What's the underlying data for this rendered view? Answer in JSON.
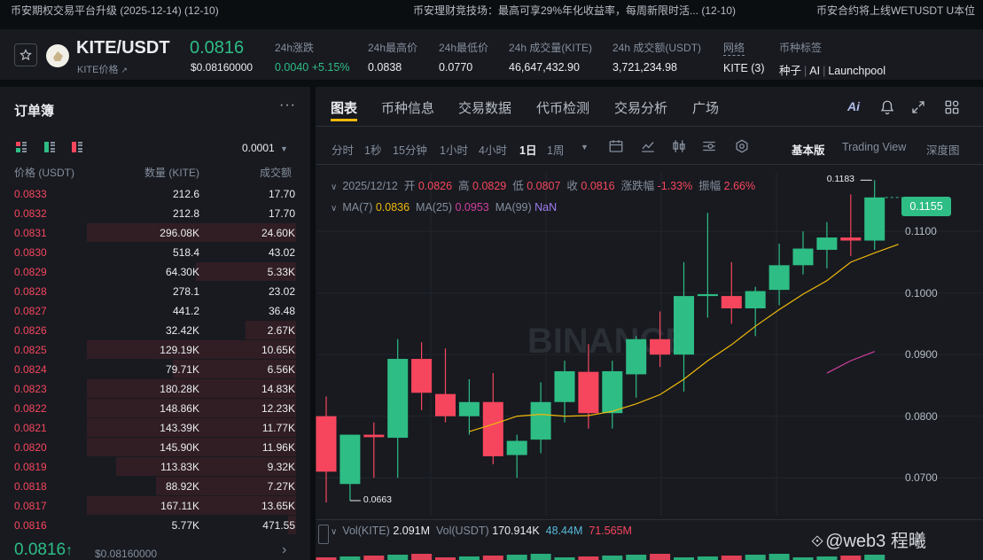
{
  "announcements": [
    "币安期权交易平台升级 (2025-12-14) (12-10)",
    "币安理财竞技场：最高可享29%年化收益率，每周新限时活... (12-10)",
    "币安合约将上线WETUSDT U本位"
  ],
  "ticker": {
    "pair": "KITE/USDT",
    "sub_label": "KITE价格",
    "last_price": "0.0816",
    "last_price_usd": "$0.08160000",
    "stats": [
      {
        "label": "24h涨跌",
        "value": "0.0040 +5.15%",
        "color": "green"
      },
      {
        "label": "24h最高价",
        "value": "0.0838"
      },
      {
        "label": "24h最低价",
        "value": "0.0770"
      },
      {
        "label": "24h 成交量(KITE)",
        "value": "46,647,432.90"
      },
      {
        "label": "24h 成交额(USDT)",
        "value": "3,721,234.98"
      },
      {
        "label": "网络",
        "value": "KITE (3)"
      }
    ],
    "tags_label": "币种标签",
    "tags": [
      "种子",
      "AI",
      "Launchpool"
    ]
  },
  "orderbook": {
    "title": "订单簿",
    "more": "···",
    "precision": "0.0001",
    "headers": {
      "price": "价格 (USDT)",
      "qty": "数量 (KITE)",
      "total": "成交额"
    },
    "asks": [
      {
        "price": "0.0833",
        "qty": "212.6",
        "total": "17.70",
        "depth": 0.0
      },
      {
        "price": "0.0832",
        "qty": "212.8",
        "total": "17.70",
        "depth": 0.0
      },
      {
        "price": "0.0831",
        "qty": "296.08K",
        "total": "24.60K",
        "depth": 1.0
      },
      {
        "price": "0.0830",
        "qty": "518.4",
        "total": "43.02",
        "depth": 0.0
      },
      {
        "price": "0.0829",
        "qty": "64.30K",
        "total": "5.33K",
        "depth": 0.48
      },
      {
        "price": "0.0828",
        "qty": "278.1",
        "total": "23.02",
        "depth": 0.0
      },
      {
        "price": "0.0827",
        "qty": "441.2",
        "total": "36.48",
        "depth": 0.0
      },
      {
        "price": "0.0826",
        "qty": "32.42K",
        "total": "2.67K",
        "depth": 0.24
      },
      {
        "price": "0.0825",
        "qty": "129.19K",
        "total": "10.65K",
        "depth": 1.0
      },
      {
        "price": "0.0824",
        "qty": "79.71K",
        "total": "6.56K",
        "depth": 0.59
      },
      {
        "price": "0.0823",
        "qty": "180.28K",
        "total": "14.83K",
        "depth": 1.0
      },
      {
        "price": "0.0822",
        "qty": "148.86K",
        "total": "12.23K",
        "depth": 1.0
      },
      {
        "price": "0.0821",
        "qty": "143.39K",
        "total": "11.77K",
        "depth": 1.0
      },
      {
        "price": "0.0820",
        "qty": "145.90K",
        "total": "11.96K",
        "depth": 1.0
      },
      {
        "price": "0.0819",
        "qty": "113.83K",
        "total": "9.32K",
        "depth": 0.86
      },
      {
        "price": "0.0818",
        "qty": "88.92K",
        "total": "7.27K",
        "depth": 0.67
      },
      {
        "price": "0.0817",
        "qty": "167.11K",
        "total": "13.65K",
        "depth": 1.0
      },
      {
        "price": "0.0816",
        "qty": "5.77K",
        "total": "471.55",
        "depth": 0.04
      }
    ],
    "last_price": "0.0816",
    "last_arrow": "↑",
    "last_price_usd": "$0.08160000",
    "last_chevron": "›"
  },
  "chart": {
    "tabs": [
      "图表",
      "币种信息",
      "交易数据",
      "代币检测",
      "交易分析",
      "广场"
    ],
    "intervals": [
      "分时",
      "1秒",
      "15分钟",
      "1小时",
      "4小时",
      "1日",
      "1周"
    ],
    "active_interval": "1日",
    "views": [
      "基本版",
      "Trading View",
      "深度图"
    ],
    "ohlc": {
      "date": "2025/12/12",
      "open_label": "开",
      "open": "0.0826",
      "high_label": "高",
      "high": "0.0829",
      "low_label": "低",
      "low": "0.0807",
      "close_label": "收",
      "close": "0.0816",
      "change_label": "涨跌幅",
      "change": "-1.33%",
      "amp_label": "振幅",
      "amp": "2.66%"
    },
    "ma": {
      "ma7_label": "MA(7)",
      "ma7": "0.0836",
      "ma25_label": "MA(25)",
      "ma25": "0.0953",
      "ma99_label": "MA(99)",
      "ma99": "NaN"
    },
    "vol": {
      "kite_label": "Vol(KITE)",
      "kite": "2.091M",
      "usdt_label": "Vol(USDT)",
      "usdt": "170.914K",
      "v1": "48.44M",
      "v2": "71.565M"
    },
    "current_price_tag": "0.1155",
    "high_marker": "0.1183",
    "low_marker": "0.0663",
    "watermark": "BINANCE",
    "y_axis": [
      {
        "value": 0.11,
        "label": "0.1100"
      },
      {
        "value": 0.1,
        "label": "0.1000"
      },
      {
        "value": 0.09,
        "label": "0.0900"
      },
      {
        "value": 0.08,
        "label": "0.0800"
      },
      {
        "value": 0.07,
        "label": "0.0700"
      }
    ],
    "colors": {
      "up": "#2ebd85",
      "down": "#f6465d",
      "ma7": "#f0b90b",
      "ma25": "#d33fa0",
      "accent": "#f0b90b"
    }
  },
  "chart_data": {
    "type": "candlestick",
    "y_range": [
      0.064,
      0.1195
    ],
    "candles": [
      {
        "o": 0.08,
        "h": 0.0832,
        "l": 0.066,
        "c": 0.071
      },
      {
        "o": 0.069,
        "h": 0.077,
        "l": 0.0663,
        "c": 0.077
      },
      {
        "o": 0.077,
        "h": 0.079,
        "l": 0.07,
        "c": 0.0766
      },
      {
        "o": 0.0765,
        "h": 0.0925,
        "l": 0.07,
        "c": 0.0893
      },
      {
        "o": 0.0893,
        "h": 0.092,
        "l": 0.081,
        "c": 0.0838
      },
      {
        "o": 0.0836,
        "h": 0.091,
        "l": 0.079,
        "c": 0.08
      },
      {
        "o": 0.08,
        "h": 0.086,
        "l": 0.077,
        "c": 0.0823
      },
      {
        "o": 0.0823,
        "h": 0.087,
        "l": 0.0722,
        "c": 0.0735
      },
      {
        "o": 0.0737,
        "h": 0.077,
        "l": 0.07,
        "c": 0.076
      },
      {
        "o": 0.0762,
        "h": 0.0855,
        "l": 0.074,
        "c": 0.0823
      },
      {
        "o": 0.0823,
        "h": 0.089,
        "l": 0.079,
        "c": 0.0873
      },
      {
        "o": 0.0872,
        "h": 0.0917,
        "l": 0.078,
        "c": 0.0805
      },
      {
        "o": 0.0805,
        "h": 0.089,
        "l": 0.078,
        "c": 0.0873
      },
      {
        "o": 0.0868,
        "h": 0.093,
        "l": 0.083,
        "c": 0.0925
      },
      {
        "o": 0.0925,
        "h": 0.097,
        "l": 0.088,
        "c": 0.09
      },
      {
        "o": 0.09,
        "h": 0.105,
        "l": 0.084,
        "c": 0.0995
      },
      {
        "o": 0.0995,
        "h": 0.113,
        "l": 0.096,
        "c": 0.0998
      },
      {
        "o": 0.0995,
        "h": 0.105,
        "l": 0.095,
        "c": 0.0975
      },
      {
        "o": 0.0975,
        "h": 0.101,
        "l": 0.093,
        "c": 0.1003
      },
      {
        "o": 0.1005,
        "h": 0.108,
        "l": 0.098,
        "c": 0.1045
      },
      {
        "o": 0.1045,
        "h": 0.11,
        "l": 0.103,
        "c": 0.1072
      },
      {
        "o": 0.107,
        "h": 0.1115,
        "l": 0.104,
        "c": 0.109
      },
      {
        "o": 0.109,
        "h": 0.116,
        "l": 0.106,
        "c": 0.1085
      },
      {
        "o": 0.1085,
        "h": 0.1183,
        "l": 0.107,
        "c": 0.1155
      }
    ],
    "ma7": [
      null,
      null,
      null,
      null,
      null,
      null,
      0.0775,
      0.0787,
      0.08,
      0.0803,
      0.08,
      0.0801,
      0.0808,
      0.082,
      0.0835,
      0.086,
      0.089,
      0.0916,
      0.0946,
      0.0973,
      0.0998,
      0.102,
      0.105,
      0.1065
    ],
    "ma25": [
      null,
      null,
      null,
      null,
      null,
      null,
      null,
      null,
      null,
      null,
      null,
      null,
      null,
      null,
      null,
      null,
      null,
      null,
      null,
      null,
      null,
      0.087,
      0.089,
      0.0905
    ],
    "ma99": []
  }
}
